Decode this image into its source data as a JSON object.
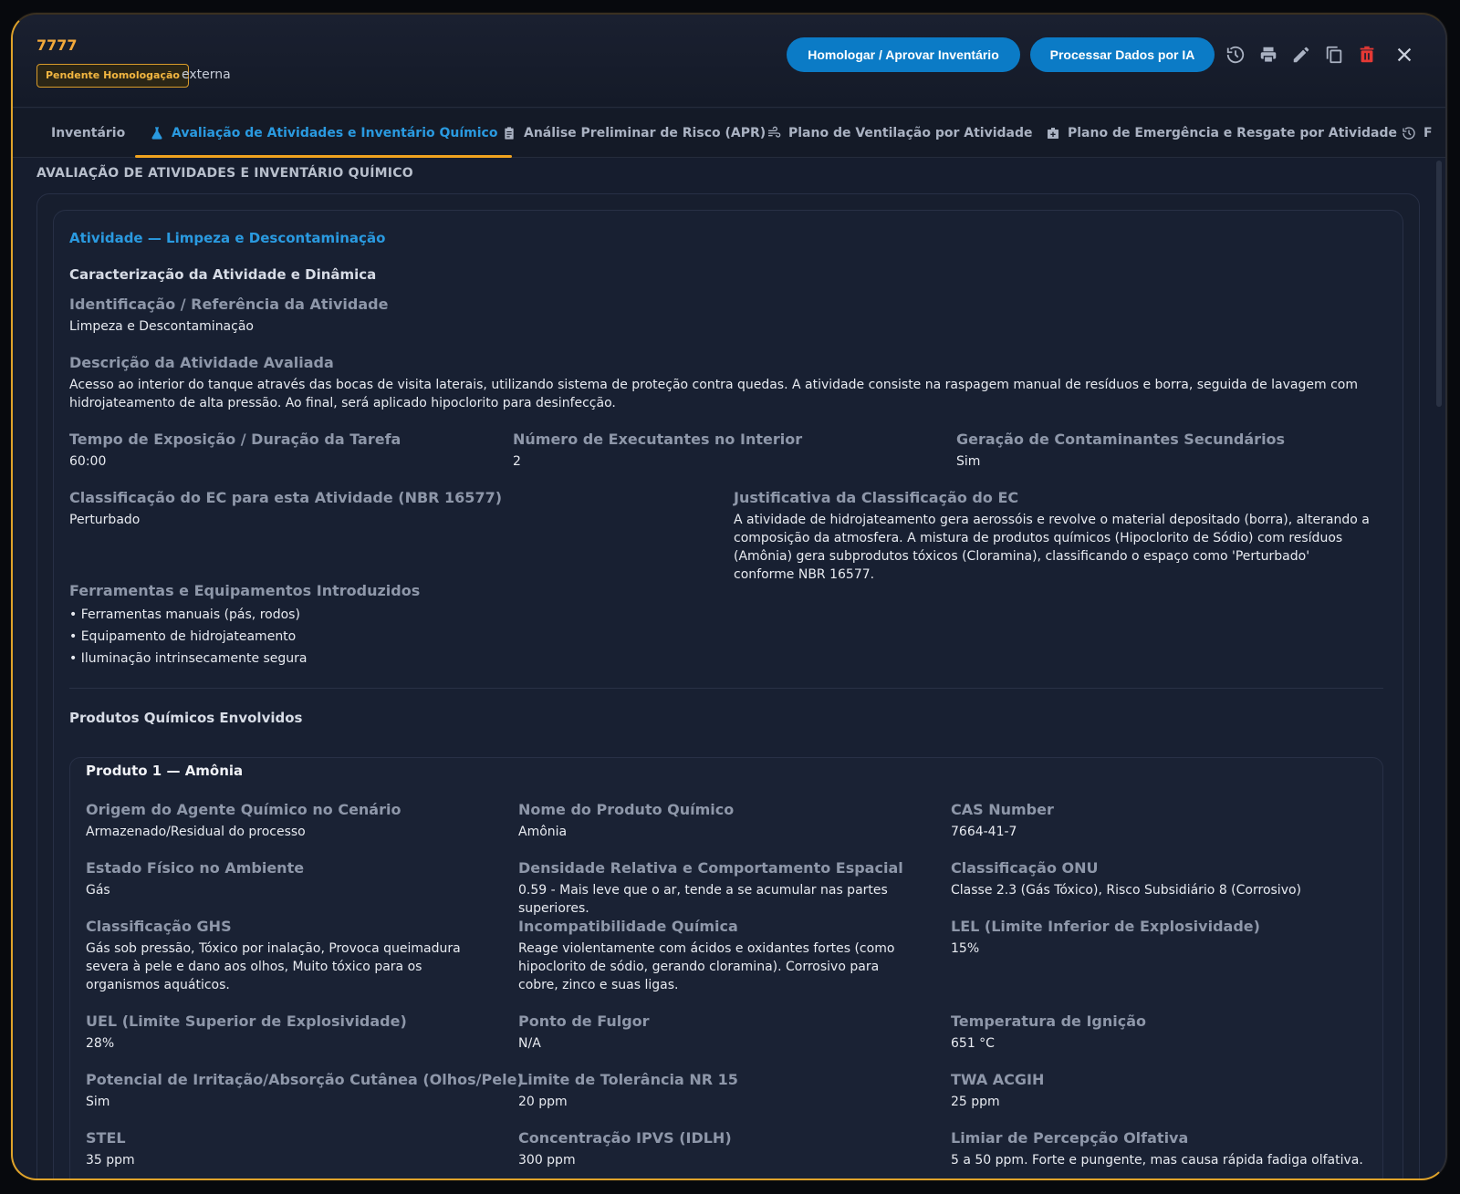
{
  "header": {
    "code": "7777",
    "status_badge": "Pendente Homologação",
    "type": "externa",
    "approve_label": "Homologar / Aprovar Inventário",
    "ai_label": "Processar Dados por IA"
  },
  "tabs": [
    {
      "label": "Inventário"
    },
    {
      "label": "Avaliação de Atividades e Inventário Químico"
    },
    {
      "label": "Análise Preliminar de Risco (APR)"
    },
    {
      "label": "Plano de Ventilação por Atividade"
    },
    {
      "label": "Plano de Emergência e Resgate por Atividade"
    },
    {
      "label": "F"
    }
  ],
  "section_title": "AVALIAÇÃO DE ATIVIDADES E INVENTÁRIO QUÍMICO",
  "activity": {
    "title": "Atividade — Limpeza e Descontaminação",
    "subtitle": "Caracterização da Atividade e Dinâmica",
    "fields": {
      "id_label": "Identificação / Referência da Atividade",
      "id_value": "Limpeza e Descontaminação",
      "desc_label": "Descrição da Atividade Avaliada",
      "desc_value": "Acesso ao interior do tanque através das bocas de visita laterais, utilizando sistema de proteção contra quedas. A atividade consiste na raspagem manual de resíduos e borra, seguida de lavagem com hidrojateamento de alta pressão. Ao final, será aplicado hipoclorito para desinfecção.",
      "time_label": "Tempo de Exposição / Duração da Tarefa",
      "time_value": "60:00",
      "workers_label": "Número de Executantes no Interior",
      "workers_value": "2",
      "secondary_label": "Geração de Contaminantes Secundários",
      "secondary_value": "Sim",
      "ec_label": "Classificação do EC para esta Atividade (NBR 16577)",
      "ec_value": "Perturbado",
      "just_label": "Justificativa da Classificação do EC",
      "just_value": "A atividade de hidrojateamento gera aerossóis e revolve o material depositado (borra), alterando a composição da atmosfera. A mistura de produtos químicos (Hipoclorito de Sódio) com resíduos (Amônia) gera subprodutos tóxicos (Cloramina), classificando o espaço como 'Perturbado' conforme NBR 16577.",
      "tools_label": "Ferramentas e Equipamentos Introduzidos",
      "tools": [
        "• Ferramentas manuais (pás, rodos)",
        "• Equipamento de hidrojateamento",
        "• Iluminação intrinsecamente segura"
      ]
    },
    "chemicals_title": "Produtos Químicos Envolvidos",
    "product": {
      "title": "Produto 1 — Amônia",
      "rows": [
        [
          {
            "label": "Origem do Agente Químico no Cenário",
            "value": "Armazenado/Residual do processo"
          },
          {
            "label": "Nome do Produto Químico",
            "value": "Amônia"
          },
          {
            "label": "CAS Number",
            "value": "7664-41-7"
          }
        ],
        [
          {
            "label": "Estado Físico no Ambiente",
            "value": "Gás"
          },
          {
            "label": "Densidade Relativa e Comportamento Espacial",
            "value": "0.59 - Mais leve que o ar, tende a se acumular nas partes superiores."
          },
          {
            "label": "Classificação ONU",
            "value": "Classe 2.3 (Gás Tóxico), Risco Subsidiário 8 (Corrosivo)"
          }
        ],
        [
          {
            "label": "Classificação GHS",
            "value": "Gás sob pressão, Tóxico por inalação, Provoca queimadura severa à pele e dano aos olhos, Muito tóxico para os organismos aquáticos."
          },
          {
            "label": "Incompatibilidade Química",
            "value": "Reage violentamente com ácidos e oxidantes fortes (como hipoclorito de sódio, gerando cloramina). Corrosivo para cobre, zinco e suas ligas."
          },
          {
            "label": "LEL (Limite Inferior de Explosividade)",
            "value": "15%"
          }
        ],
        [
          {
            "label": "UEL (Limite Superior de Explosividade)",
            "value": "28%"
          },
          {
            "label": "Ponto de Fulgor",
            "value": "N/A"
          },
          {
            "label": "Temperatura de Ignição",
            "value": "651 °C"
          }
        ],
        [
          {
            "label": "Potencial de Irritação/Absorção Cutânea (Olhos/Pele)",
            "value": "Sim"
          },
          {
            "label": "Limite de Tolerância NR 15",
            "value": "20 ppm"
          },
          {
            "label": "TWA ACGIH",
            "value": "25 ppm"
          }
        ],
        [
          {
            "label": "STEL",
            "value": "35 ppm"
          },
          {
            "label": "Concentração IPVS (IDLH)",
            "value": "300 ppm"
          },
          {
            "label": "Limiar de Percepção Olfativa",
            "value": "5 a 50 ppm. Forte e pungente, mas causa rápida fadiga olfativa."
          }
        ]
      ]
    }
  },
  "colors": {
    "accent_blue": "#2a9ae0",
    "accent_orange": "#f0a31f",
    "button_blue": "#0b7bc6",
    "delete_red": "#e53935"
  }
}
